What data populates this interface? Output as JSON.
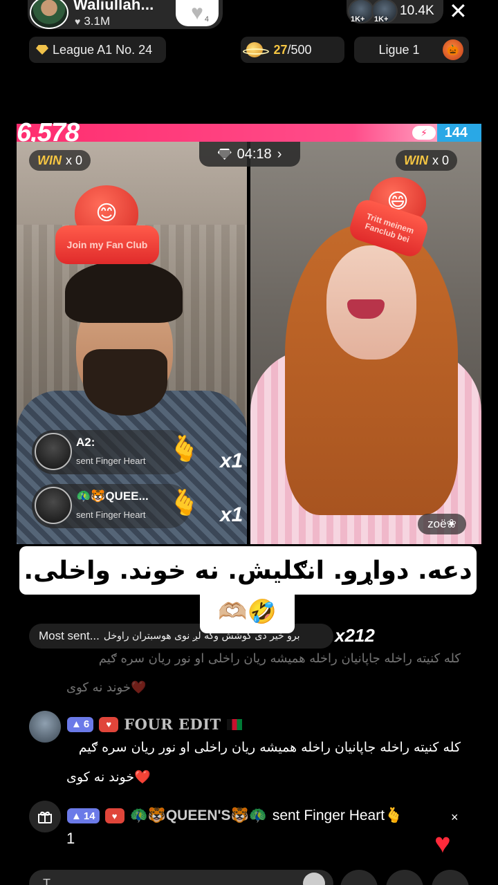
{
  "host": {
    "name": "Waliullah...",
    "likes": "3.1M",
    "follow_count": "4"
  },
  "viewers": {
    "badge_1": "1K+",
    "badge_2": "1K+",
    "count": "10.4K"
  },
  "badges": {
    "league": "League A1 No. 24",
    "progress_current": "27",
    "progress_total": "/500",
    "ligue": "Ligue 1"
  },
  "battle": {
    "score_left": "6,578",
    "score_right": "144",
    "timer": "04:18",
    "win_label": "WIN",
    "win_left": "x 0",
    "win_right": "x 0",
    "fan_banner_left": "Join my Fan Club",
    "fan_banner_right": "Tritt meinem Fanclub bei"
  },
  "gifts": [
    {
      "name": "A2:",
      "desc": "sent Finger Heart",
      "mult": "x1"
    },
    {
      "name": "🦚🐯QUEE...",
      "desc": "sent Finger Heart",
      "mult": "x1"
    }
  ],
  "opponent_name": "zoë❀",
  "caption": {
    "line1": "دعه. دواړو. انګلیش. نه خوند. واخلی.",
    "line2": "🫶🏼🤣"
  },
  "most_sent": {
    "label": "Most sent...",
    "text": "برو خیر دی کوشش وکه لږ نوی هوسبتران راوخل",
    "count": "x212"
  },
  "chat": {
    "faded_line1": "کله کنیته راخله جاپانیان راخله همیشه ریان راخلی او نور ریان سره ګیم",
    "faded_line2": "خوند نه کوی❤️",
    "message": {
      "level": "6",
      "user": "FOUR EDIT",
      "text_line1": "کله کنیته راخله جاپانیان راخله همیشه ریان راخلی او نور ریان سره ګیم",
      "text_line2": "خوند نه کوی❤️"
    },
    "gift_event": {
      "level": "14",
      "user": "🦚🐯QUEEN'S🐯🦚",
      "action": "sent Finger Heart🫰",
      "times": "×",
      "count": "1"
    }
  },
  "comment_placeholder": "T"
}
